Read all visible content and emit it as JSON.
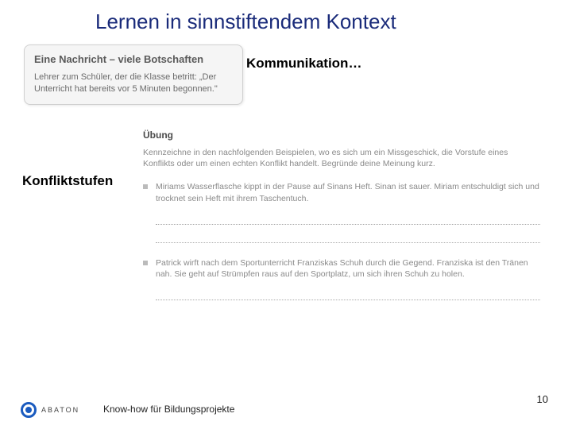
{
  "slide": {
    "title": "Lernen in sinnstiftendem Kontext",
    "label_kommunikation": "Kommunikation…",
    "label_konfliktstufen": "Konfliktstufen"
  },
  "message_box": {
    "title": "Eine Nachricht – viele Botschaften",
    "body": "Lehrer zum Schüler, der die Klasse betritt: „Der Unterricht hat bereits vor 5 Minuten begonnen.\""
  },
  "exercise": {
    "heading": "Übung",
    "intro": "Kennzeichne in den nachfolgenden Beispielen, wo es sich um ein Missgeschick, die Vorstufe eines Konflikts oder um einen echten Konflikt handelt. Begründe deine Meinung kurz.",
    "items": [
      "Miriams Wasserflasche kippt in der Pause auf Sinans Heft. Sinan ist sauer. Miriam entschuldigt sich und trocknet sein Heft mit ihrem Taschentuch.",
      "Patrick wirft nach dem Sportunterricht Franziskas Schuh durch die Gegend. Franziska ist den Tränen nah. Sie geht auf Strümpfen raus auf den Sportplatz, um sich ihren Schuh zu holen."
    ]
  },
  "footer": {
    "logo_text": "ABATON",
    "tagline": "Know-how für Bildungsprojekte",
    "page": "10"
  }
}
